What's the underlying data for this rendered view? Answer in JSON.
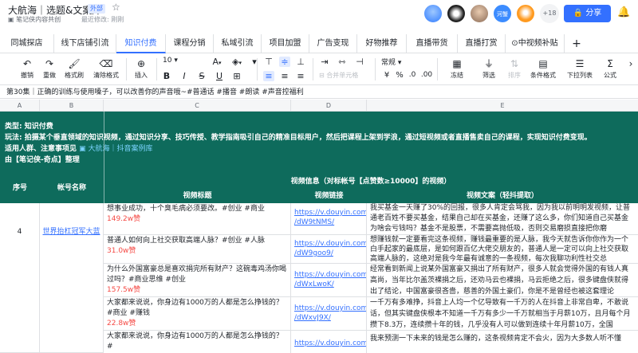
{
  "title": {
    "name": "大航海｜选题&文案库",
    "badge": "外部",
    "star_icon": "star-icon"
  },
  "location": {
    "folder": "笔记侠内容共创",
    "edited": "最近修改: 刚刚"
  },
  "header": {
    "extra_count": "+18",
    "share": "分享",
    "avatar_label": "河蟹"
  },
  "tabs": [
    "同城探店",
    "线下店铺引流",
    "知识付费",
    "课程分销",
    "私域引流",
    "项目加盟",
    "广告变现",
    "好物推荐",
    "直播带货",
    "直播打赏",
    "中视频补贴"
  ],
  "active_tab": "知识付费",
  "toolbar": {
    "undo": "撤销",
    "redo": "重做",
    "format_brush": "格式刷",
    "clear_format": "清除格式",
    "insert": "插入",
    "font_size": "10",
    "bold": "B",
    "italic": "I",
    "underline": "U",
    "strike": "S",
    "merge": "合并单元格",
    "number_format": "常规",
    "freeze": "冻结",
    "filter": "筛选",
    "sort": "排序",
    "cond_format": "条件格式",
    "dropdown": "下拉列表",
    "formula": "公式"
  },
  "formula_bar": "第30集｜正确的训练与使用嗓子，可以改善你的声音哦~#普通话 #播音 #朗读 #声音控福利",
  "columns": [
    "A",
    "B",
    "C",
    "D",
    "E"
  ],
  "header_block": {
    "line1": "类型: 知识付费",
    "line2": "玩法: 拍摄某个垂直领域的知识视频，通过知识分享、技巧传授、教学指南吸引自己的精准目标用户，然后把课程上架到学浪，通过短视频或者直播售卖自己的课程，实现知识付费变现。",
    "line3": "适用人群、注意事项见",
    "line3_link": "大航海｜抖音案例库",
    "line4": "由【笔记侠-奇点】整理",
    "video_info": "视频信息（对标帐号【点赞数≥10000】的视频）",
    "col_no": "序号",
    "col_account": "帐号名称",
    "col_title": "视频标题",
    "col_link": "视频链接",
    "col_copy": "视频文案（轻抖提取）"
  },
  "record": {
    "no": "4",
    "account": "世界抬杠冠军大蓝"
  },
  "rows": [
    {
      "title": "想事业成功，十个臭毛病必须要改。#创业 #商业",
      "likes": "149.2w赞",
      "link1": "https://v.douyin.com",
      "link2": "/dW9tNMS/",
      "copy": "我买基金一天赚了30%的回报，很多人肯定会骂我，因为我以前明明发视频，让普通老百姓不要买基金，结果自己却在买基金，还赚了这么多，你们知道自己买基金为啥会亏钱吗？基金不是股票，不需要高抛低吸，否则交易磨损直接把你磨"
    },
    {
      "title": "普通人如何向上社交获取高端人脉？#创业 #人脉",
      "likes": "31.0w赞",
      "link1": "https://v.douyin.com",
      "link2": "/dW9goo9/",
      "copy": "想赚钱就一定要看完这条视频，赚钱最重要的是人脉，我今天就告诉你你作为一个白手起家的最底层，是如何跟百亿大佬交朋友的，普通人是一定可以向上社交获取高端人脉的，这绝对是我今年最有诚意的一条视频，每次我聊功利性社交总"
    },
    {
      "title": "为什么外国富豪总是喜欢捐完所有财产？这碗毒鸡汤你喝过吗？#商业思维 #创业",
      "likes": "157.5w赞",
      "link1": "https://v.douyin.com",
      "link2": "/dWxLwoK/",
      "copy": "经常看到新闻上说某外国富豪又捐出了所有财产，很多人就会觉得外国的有钱人真高尚，当年比尔盖茨裸捐之后，还劝马云也裸捐，马云拒绝之后，很多键盘侠就得出了结论，中国富豪很吝啬，慈善的外国土豪们，你是不是曾经也被这套理论"
    },
    {
      "title": "大家都来说说，你身边有1000万的人都是怎么挣钱的？#商业 #赚钱",
      "likes": "22.8w赞",
      "link1": "https://v.douyin.com",
      "link2": "/dWxvJ9X/",
      "copy": "一千万有多难挣，抖音上人均一个亿导致有一千万的人在抖音上非常自卑，不敢说话，但其实键盘侠根本不知道一千万有多少一千万就相当于月薪10万，且月每个月攒下8.3万，连续攒十年的钱，几乎没有人可以做到连续十年月薪10万，全国"
    },
    {
      "title": "大家都来说说，你身边有1000万的人都是怎么挣钱的？#",
      "likes": "",
      "link1": "https://v.douyin.com",
      "link2": "",
      "copy": "我来预测一下未来的钱是怎么赚的，这条视频肯定不会火，因为大多数人听不懂"
    }
  ]
}
